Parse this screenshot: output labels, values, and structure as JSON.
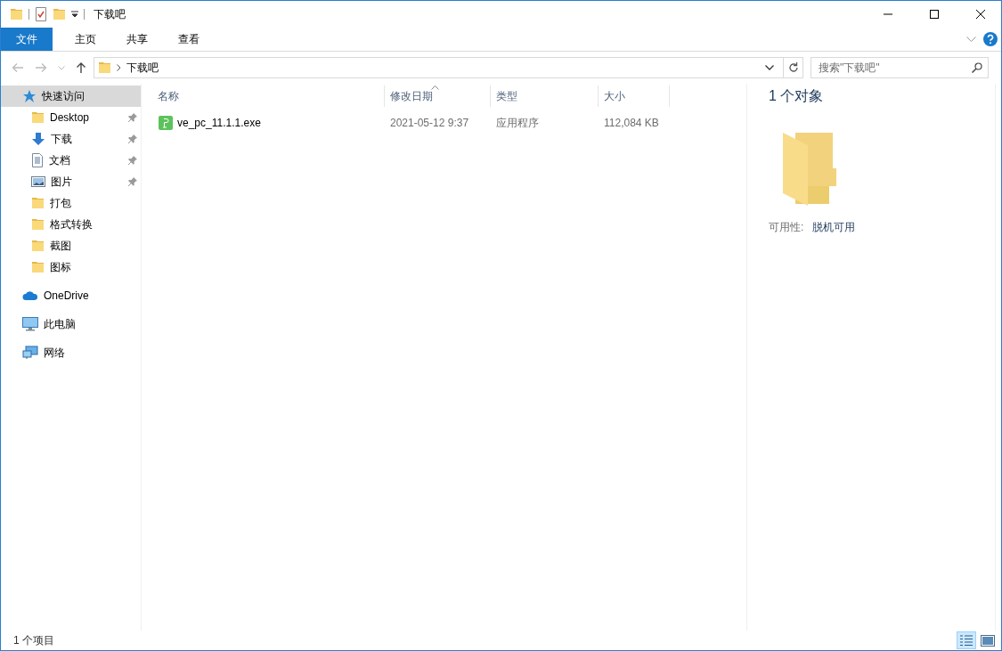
{
  "window": {
    "title": "下载吧"
  },
  "ribbon": {
    "tabs": [
      {
        "label": "文件",
        "kind": "file",
        "selected": false
      },
      {
        "label": "主页",
        "kind": "tab",
        "selected": false
      },
      {
        "label": "共享",
        "kind": "tab",
        "selected": false
      },
      {
        "label": "查看",
        "kind": "tab",
        "selected": false
      }
    ]
  },
  "address": {
    "path": [
      "下载吧"
    ],
    "search_placeholder": "搜索\"下载吧\""
  },
  "nav": {
    "items": [
      {
        "label": "快速访问",
        "kind": "star",
        "selected": true,
        "children": [
          {
            "label": "Desktop",
            "kind": "folder",
            "pinned": true,
            "selected": false
          },
          {
            "label": "下载",
            "kind": "download",
            "pinned": true,
            "selected": false
          },
          {
            "label": "文档",
            "kind": "document",
            "pinned": true,
            "selected": false
          },
          {
            "label": "图片",
            "kind": "picture",
            "pinned": true,
            "selected": false
          },
          {
            "label": "打包",
            "kind": "folder",
            "pinned": false,
            "selected": false
          },
          {
            "label": "格式转换",
            "kind": "folder",
            "pinned": false,
            "selected": false
          },
          {
            "label": "截图",
            "kind": "folder",
            "pinned": false,
            "selected": false
          },
          {
            "label": "图标",
            "kind": "folder",
            "pinned": false,
            "selected": false
          }
        ]
      },
      {
        "label": "OneDrive",
        "kind": "cloud",
        "selected": false
      },
      {
        "label": "此电脑",
        "kind": "computer",
        "selected": false
      },
      {
        "label": "网络",
        "kind": "network",
        "selected": false
      }
    ]
  },
  "table": {
    "columns": [
      {
        "label": "名称",
        "sorted": false
      },
      {
        "label": "修改日期",
        "sorted": true
      },
      {
        "label": "类型",
        "sorted": false
      },
      {
        "label": "大小",
        "sorted": false
      }
    ],
    "rows": [
      {
        "kind": "exe",
        "selected": false,
        "cells": [
          "ve_pc_11.1.1.exe",
          "2021-05-12 9:37",
          "应用程序",
          "112,084 KB"
        ]
      }
    ]
  },
  "preview": {
    "title": "1 个对象",
    "properties": [
      {
        "label": "可用性:",
        "value": "脱机可用"
      }
    ]
  },
  "status_bar": {
    "text": "1 个项目",
    "views": [
      {
        "kind": "details",
        "selected": true
      },
      {
        "kind": "large-icons",
        "selected": false
      }
    ]
  }
}
